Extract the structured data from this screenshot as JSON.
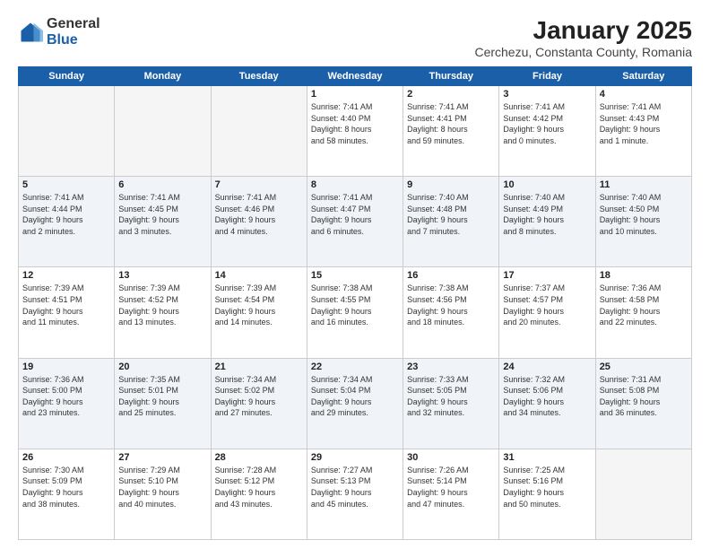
{
  "logo": {
    "general": "General",
    "blue": "Blue"
  },
  "title": "January 2025",
  "subtitle": "Cerchezu, Constanta County, Romania",
  "days_of_week": [
    "Sunday",
    "Monday",
    "Tuesday",
    "Wednesday",
    "Thursday",
    "Friday",
    "Saturday"
  ],
  "weeks": [
    [
      {
        "day": "",
        "info": ""
      },
      {
        "day": "",
        "info": ""
      },
      {
        "day": "",
        "info": ""
      },
      {
        "day": "1",
        "info": "Sunrise: 7:41 AM\nSunset: 4:40 PM\nDaylight: 8 hours\nand 58 minutes."
      },
      {
        "day": "2",
        "info": "Sunrise: 7:41 AM\nSunset: 4:41 PM\nDaylight: 8 hours\nand 59 minutes."
      },
      {
        "day": "3",
        "info": "Sunrise: 7:41 AM\nSunset: 4:42 PM\nDaylight: 9 hours\nand 0 minutes."
      },
      {
        "day": "4",
        "info": "Sunrise: 7:41 AM\nSunset: 4:43 PM\nDaylight: 9 hours\nand 1 minute."
      }
    ],
    [
      {
        "day": "5",
        "info": "Sunrise: 7:41 AM\nSunset: 4:44 PM\nDaylight: 9 hours\nand 2 minutes."
      },
      {
        "day": "6",
        "info": "Sunrise: 7:41 AM\nSunset: 4:45 PM\nDaylight: 9 hours\nand 3 minutes."
      },
      {
        "day": "7",
        "info": "Sunrise: 7:41 AM\nSunset: 4:46 PM\nDaylight: 9 hours\nand 4 minutes."
      },
      {
        "day": "8",
        "info": "Sunrise: 7:41 AM\nSunset: 4:47 PM\nDaylight: 9 hours\nand 6 minutes."
      },
      {
        "day": "9",
        "info": "Sunrise: 7:40 AM\nSunset: 4:48 PM\nDaylight: 9 hours\nand 7 minutes."
      },
      {
        "day": "10",
        "info": "Sunrise: 7:40 AM\nSunset: 4:49 PM\nDaylight: 9 hours\nand 8 minutes."
      },
      {
        "day": "11",
        "info": "Sunrise: 7:40 AM\nSunset: 4:50 PM\nDaylight: 9 hours\nand 10 minutes."
      }
    ],
    [
      {
        "day": "12",
        "info": "Sunrise: 7:39 AM\nSunset: 4:51 PM\nDaylight: 9 hours\nand 11 minutes."
      },
      {
        "day": "13",
        "info": "Sunrise: 7:39 AM\nSunset: 4:52 PM\nDaylight: 9 hours\nand 13 minutes."
      },
      {
        "day": "14",
        "info": "Sunrise: 7:39 AM\nSunset: 4:54 PM\nDaylight: 9 hours\nand 14 minutes."
      },
      {
        "day": "15",
        "info": "Sunrise: 7:38 AM\nSunset: 4:55 PM\nDaylight: 9 hours\nand 16 minutes."
      },
      {
        "day": "16",
        "info": "Sunrise: 7:38 AM\nSunset: 4:56 PM\nDaylight: 9 hours\nand 18 minutes."
      },
      {
        "day": "17",
        "info": "Sunrise: 7:37 AM\nSunset: 4:57 PM\nDaylight: 9 hours\nand 20 minutes."
      },
      {
        "day": "18",
        "info": "Sunrise: 7:36 AM\nSunset: 4:58 PM\nDaylight: 9 hours\nand 22 minutes."
      }
    ],
    [
      {
        "day": "19",
        "info": "Sunrise: 7:36 AM\nSunset: 5:00 PM\nDaylight: 9 hours\nand 23 minutes."
      },
      {
        "day": "20",
        "info": "Sunrise: 7:35 AM\nSunset: 5:01 PM\nDaylight: 9 hours\nand 25 minutes."
      },
      {
        "day": "21",
        "info": "Sunrise: 7:34 AM\nSunset: 5:02 PM\nDaylight: 9 hours\nand 27 minutes."
      },
      {
        "day": "22",
        "info": "Sunrise: 7:34 AM\nSunset: 5:04 PM\nDaylight: 9 hours\nand 29 minutes."
      },
      {
        "day": "23",
        "info": "Sunrise: 7:33 AM\nSunset: 5:05 PM\nDaylight: 9 hours\nand 32 minutes."
      },
      {
        "day": "24",
        "info": "Sunrise: 7:32 AM\nSunset: 5:06 PM\nDaylight: 9 hours\nand 34 minutes."
      },
      {
        "day": "25",
        "info": "Sunrise: 7:31 AM\nSunset: 5:08 PM\nDaylight: 9 hours\nand 36 minutes."
      }
    ],
    [
      {
        "day": "26",
        "info": "Sunrise: 7:30 AM\nSunset: 5:09 PM\nDaylight: 9 hours\nand 38 minutes."
      },
      {
        "day": "27",
        "info": "Sunrise: 7:29 AM\nSunset: 5:10 PM\nDaylight: 9 hours\nand 40 minutes."
      },
      {
        "day": "28",
        "info": "Sunrise: 7:28 AM\nSunset: 5:12 PM\nDaylight: 9 hours\nand 43 minutes."
      },
      {
        "day": "29",
        "info": "Sunrise: 7:27 AM\nSunset: 5:13 PM\nDaylight: 9 hours\nand 45 minutes."
      },
      {
        "day": "30",
        "info": "Sunrise: 7:26 AM\nSunset: 5:14 PM\nDaylight: 9 hours\nand 47 minutes."
      },
      {
        "day": "31",
        "info": "Sunrise: 7:25 AM\nSunset: 5:16 PM\nDaylight: 9 hours\nand 50 minutes."
      },
      {
        "day": "",
        "info": ""
      }
    ]
  ]
}
